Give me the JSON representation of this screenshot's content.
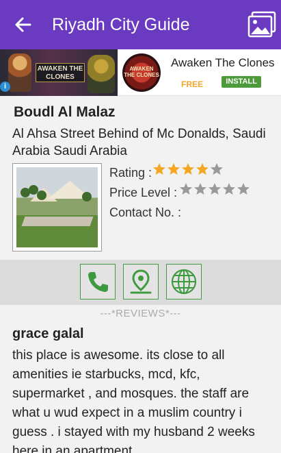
{
  "appbar": {
    "title": "Riyadh City Guide",
    "back_icon": "arrow-left-icon",
    "gallery_icon": "image-gallery-icon",
    "background": "#6a3bc0"
  },
  "ad": {
    "banner_text": "AWAKEN THE CLONES",
    "app_icon_text": "AWAKEN THE CLONES",
    "title": "Awaken The Clones",
    "price": "FREE",
    "install_label": "INSTALL",
    "info_icon": "i"
  },
  "place": {
    "name": "Boudl Al Malaz",
    "address": "Al Ahsa Street Behind of Mc Donalds, Saudi Arabia Saudi Arabia",
    "rating_label": "Rating :",
    "rating_value": 4,
    "rating_max": 5,
    "price_label": "Price Level :",
    "price_value": 0,
    "price_max": 5,
    "contact_label": "Contact No. :"
  },
  "actions": [
    {
      "name": "call",
      "icon": "phone-icon"
    },
    {
      "name": "map",
      "icon": "map-pin-icon"
    },
    {
      "name": "website",
      "icon": "globe-icon"
    }
  ],
  "reviews": {
    "heading": "---*REVIEWS*---",
    "items": [
      {
        "author": "grace galal",
        "text": "this place is awesome. its close to all amenities ie starbucks, mcd, kfc, supermarket , and mosques. the staff are what u wud expect in a muslim country i guess . i stayed with my husband 2 weeks here in an apartment"
      }
    ]
  },
  "colors": {
    "accent": "#6a3bc0",
    "star_filled": "#f5a623",
    "star_empty": "#9a9a9a",
    "action_green": "#3e9a3e"
  }
}
